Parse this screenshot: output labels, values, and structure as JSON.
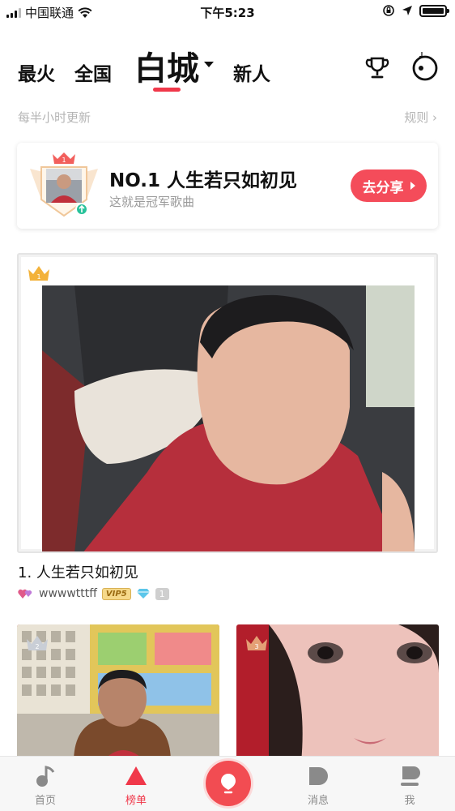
{
  "status_bar": {
    "carrier": "中国联通",
    "time": "下午5:23"
  },
  "top_nav": {
    "tabs": [
      {
        "label": "最火"
      },
      {
        "label": "全国"
      },
      {
        "label": "白城"
      },
      {
        "label": "新人"
      }
    ],
    "active_tab": "白城",
    "trophy_icon": "trophy-icon",
    "music_icon": "music-disc-icon"
  },
  "subbar": {
    "update_note": "每半小时更新",
    "rules_label": "规则 ›"
  },
  "champion": {
    "badge_rank": "1",
    "title": "NO.1 人生若只如初见",
    "subtitle": "这就是冠军歌曲",
    "share_label": "去分享"
  },
  "first_entry": {
    "rank": "1",
    "song_title": "1. 人生若只如初见",
    "username": "wwwwtttff",
    "vip_label": "VIP5",
    "gem_count": "1"
  },
  "small_entries": [
    {
      "rank": "2"
    },
    {
      "rank": "3"
    }
  ],
  "tab_bar": {
    "items": [
      {
        "label": "首页",
        "icon": "note-icon"
      },
      {
        "label": "榜单",
        "icon": "chart-triangle-icon"
      },
      {
        "label": "消息",
        "icon": "message-icon"
      },
      {
        "label": "我",
        "icon": "profile-icon"
      }
    ],
    "active": "榜单"
  },
  "colors": {
    "accent": "#f0384a",
    "share_button": "#f44c5a",
    "muted_text": "#b5b5b5"
  }
}
